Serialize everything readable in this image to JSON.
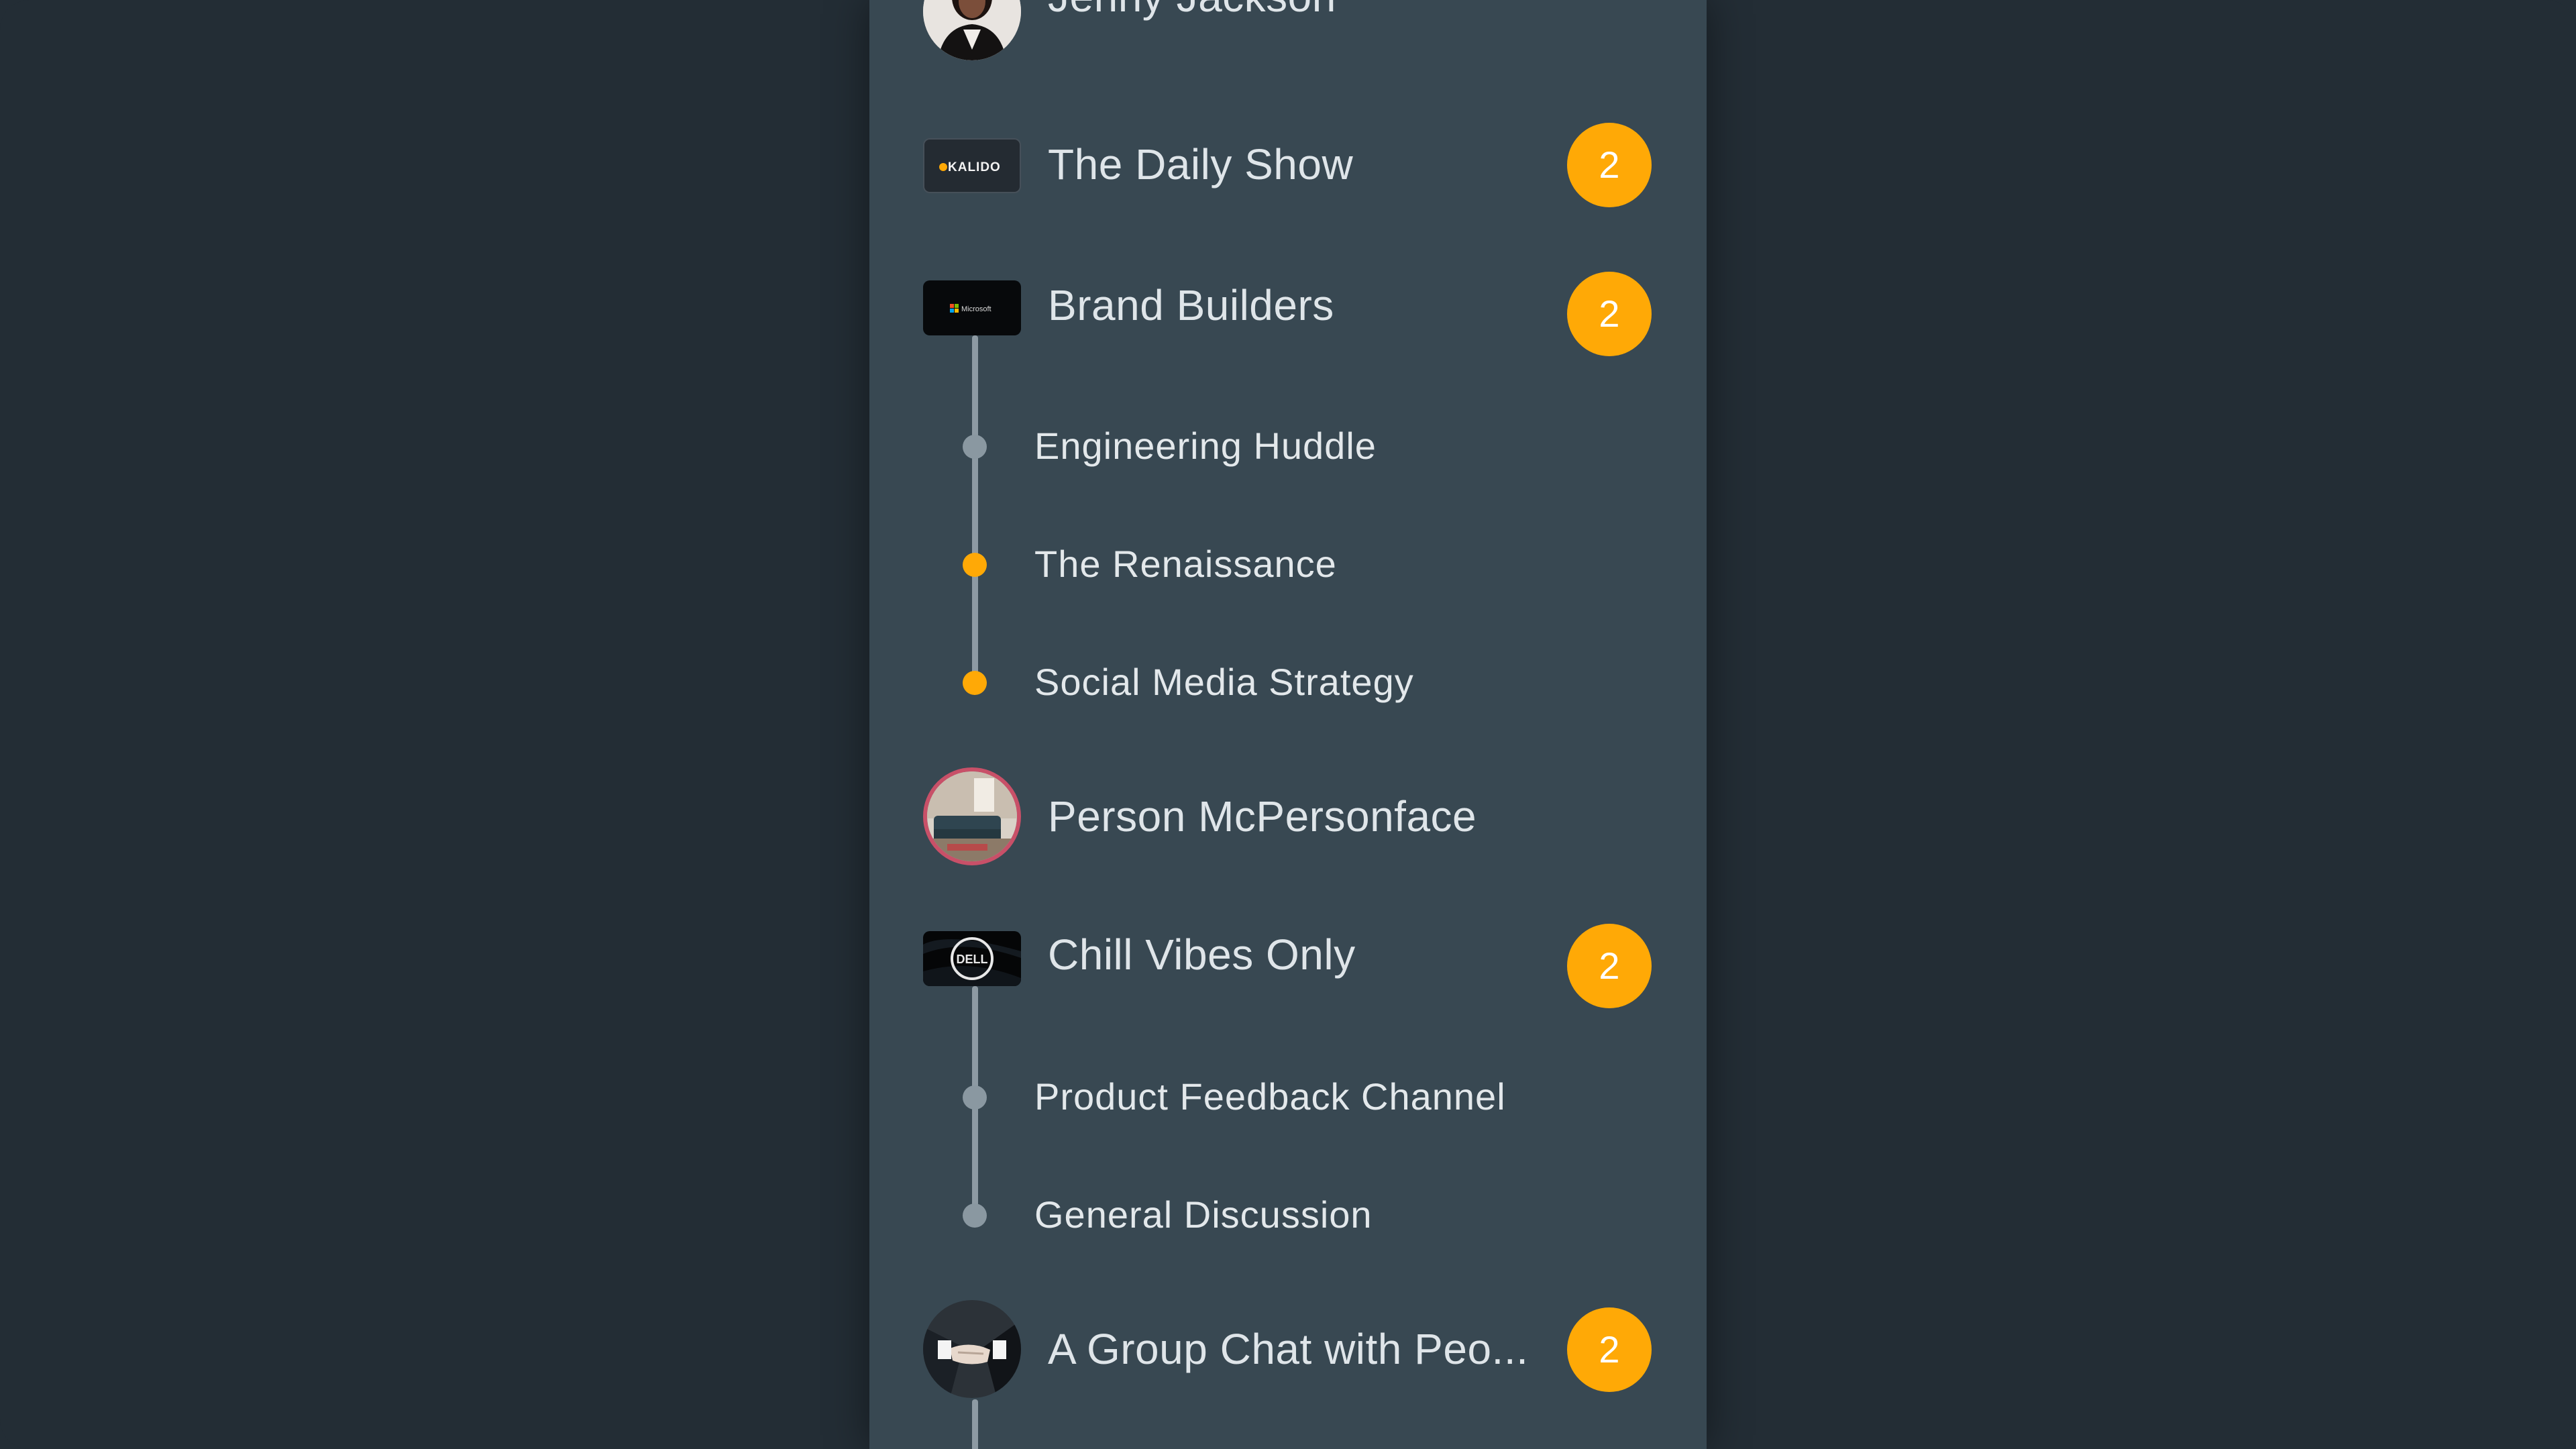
{
  "colors": {
    "background": "#232d35",
    "panel": "#384852",
    "accent": "#ffa906",
    "line": "#8d9aa3",
    "text": "#dfe5e9"
  },
  "conversations": [
    {
      "title": "Jenny Jackson",
      "avatar": "person-photo-avatar"
    },
    {
      "title": "The Daily Show",
      "avatar": "kalido-logo",
      "logo_text": "KALIDO",
      "badge": "2"
    },
    {
      "title": "Brand Builders",
      "avatar": "microsoft-logo",
      "logo_text": "Microsoft",
      "badge": "2",
      "channels": [
        {
          "label": "Engineering Huddle",
          "unread": false
        },
        {
          "label": "The Renaissance",
          "unread": true
        },
        {
          "label": "Social Media Strategy",
          "unread": true
        }
      ]
    },
    {
      "title": "Person McPersonface",
      "avatar": "living-room-photo-avatar"
    },
    {
      "title": "Chill Vibes Only",
      "avatar": "dell-logo",
      "logo_text": "DELL",
      "badge": "2",
      "channels": [
        {
          "label": "Product Feedback Channel",
          "unread": false
        },
        {
          "label": "General Discussion",
          "unread": false
        }
      ]
    },
    {
      "title": "A Group Chat with Peo...",
      "avatar": "handshake-photo-avatar",
      "badge": "2"
    }
  ]
}
